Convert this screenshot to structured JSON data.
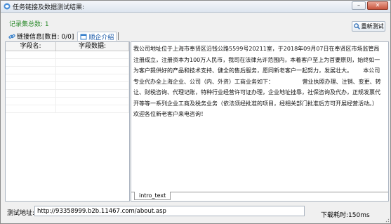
{
  "window": {
    "title": "任务链接及数据测试结果:",
    "minimize_glyph": "–",
    "close_glyph": "✕"
  },
  "summary": {
    "record_count_label": "记录集总数: 1"
  },
  "toolbar": {
    "retest_label": "重新测试"
  },
  "tabs": [
    {
      "label": "链接信息[数目: 0/0]",
      "icon": "link-icon"
    },
    {
      "label": "顺企介绍",
      "icon": "window-icon"
    }
  ],
  "table": {
    "columns": [
      "字段名:",
      "字段数据:"
    ]
  },
  "content": {
    "text": "我公司地址位于上海市奉贤区沿钱公路5599号20211室，于2018年09月07日在奉贤区市场监管局注册成立，注册资本为100万人民币，我司在法律允许范围内，本着客户至上为首要原则，始终如一为客户提供好的产品和技术支持、健全的售后服务，愿同新老客户一起努力，发展壮大。      本公司专业代办全上海企业、公司（内、外资）工商业务如下：                营业执照办理、注销、变更、转让、财税咨询、代理记账，特种行业经营许可证办理，企业地址挂靠，社保咨询及代办，正规发票代开等等一系列企业工商及税务业务（依法须经批准的项目，经相关部门批准后方可开展经营活动。）       欢迎各位新老客户来电咨询！",
    "bottom_tab": "intro_text"
  },
  "footer": {
    "url_label": "测试地址:",
    "url_value": "http://93358999.b2b.11467.com/about.asp",
    "elapsed_label": "下载耗时:150ms"
  },
  "colors": {
    "count_green": "#2b8a2b",
    "tab_active_blue": "#1556a6"
  }
}
